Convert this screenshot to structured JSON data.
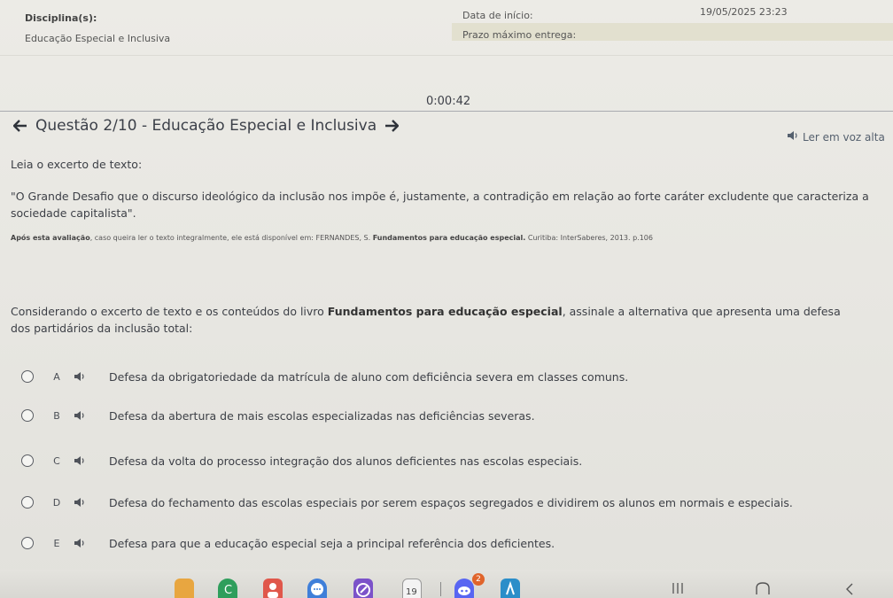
{
  "header": {
    "discipline_label": "Disciplina(s):",
    "discipline_value": "Educação Especial e Inclusiva",
    "start_label": "Data de início:",
    "start_value": "19/05/2025 23:23",
    "deadline_label": "Prazo máximo entrega:"
  },
  "timer": "0:00:42",
  "question": {
    "title": "Questão 2/10 - Educação Especial e Inclusiva",
    "read_aloud": "Ler em voz alta",
    "intro": "Leia o excerto de texto:",
    "quote": "\"O Grande Desafio que o discurso ideológico da inclusão nos impõe é, justamente, a contradição em relação ao forte caráter excludente que caracteriza a sociedade capitalista\".",
    "source_bold_1": "Após esta avaliação",
    "source_text_1": ", caso queira ler o texto integralmente, ele está disponível em: FERNANDES, S. ",
    "source_bold_2": "Fundamentos para educação especial.",
    "source_text_2": " Curitiba: InterSaberes, 2013. p.106",
    "prompt_pre": "Considerando o excerto de texto e os conteúdos do livro ",
    "prompt_bold": "Fundamentos para educação especial",
    "prompt_post": ", assinale a alternativa que apresenta uma defesa dos partidários da inclusão total:"
  },
  "options": [
    {
      "letter": "A",
      "text": "Defesa da obrigatoriedade da matrícula de aluno com deficiência severa em classes comuns."
    },
    {
      "letter": "B",
      "text": "Defesa da abertura de mais escolas especializadas nas deficiências severas."
    },
    {
      "letter": "C",
      "text": "Defesa da volta do processo integração dos alunos deficientes nas escolas especiais."
    },
    {
      "letter": "D",
      "text": "Defesa do fechamento das escolas especiais por serem espaços segregados e dividirem os alunos em normais e especiais."
    },
    {
      "letter": "E",
      "text": "Defesa para que a educação especial seja a principal referência dos deficientes."
    }
  ],
  "taskbar": {
    "calendar_day": "19",
    "notification_badge": "2",
    "apps": [
      "folder-app-icon",
      "messages-app-icon",
      "contacts-app-icon",
      "chat-app-icon",
      "edit-app-icon",
      "calendar-app-icon",
      "discord-app-icon",
      "gallery-app-icon"
    ]
  },
  "colors": {
    "background": "#e9e8e3",
    "text": "#3c3f46",
    "deadline_band": "#e2e0cf"
  }
}
